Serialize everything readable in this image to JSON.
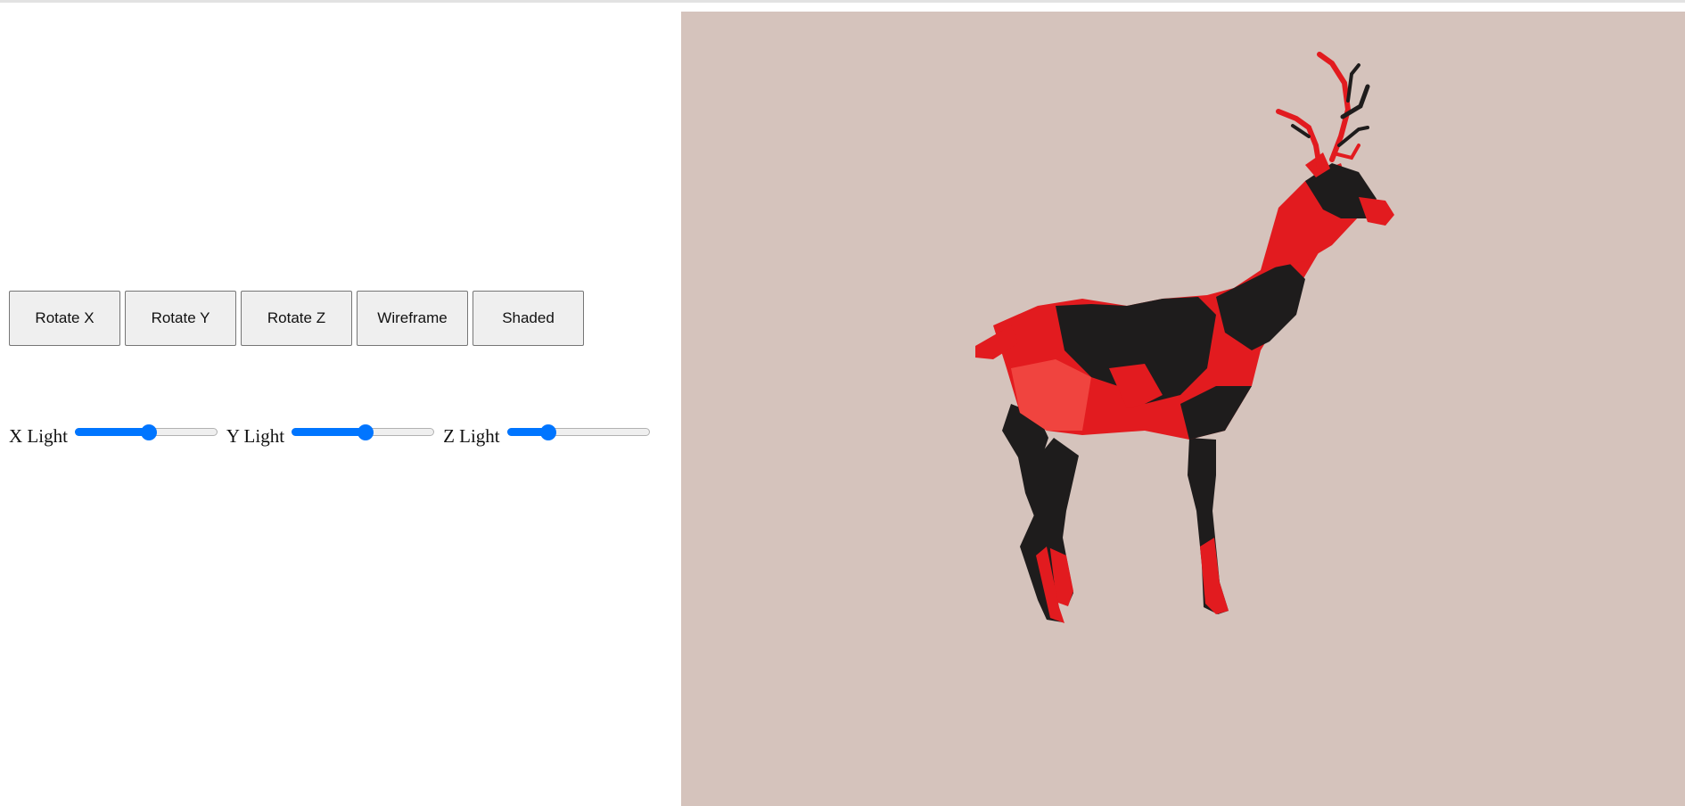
{
  "toolbar": {
    "buttons": [
      {
        "label": "Rotate X"
      },
      {
        "label": "Rotate Y"
      },
      {
        "label": "Rotate Z"
      },
      {
        "label": "Wireframe"
      },
      {
        "label": "Shaded"
      }
    ]
  },
  "lights": [
    {
      "label": "X Light",
      "value": 0.52
    },
    {
      "label": "Y Light",
      "value": 0.52
    },
    {
      "label": "Z Light",
      "value": 0.29
    }
  ],
  "viewport": {
    "background": "#d5c3bc",
    "model": "low-poly deer",
    "model_colors": {
      "primary": "#e21b1f",
      "dark": "#1e1c1c",
      "highlight": "#f0443f"
    }
  }
}
